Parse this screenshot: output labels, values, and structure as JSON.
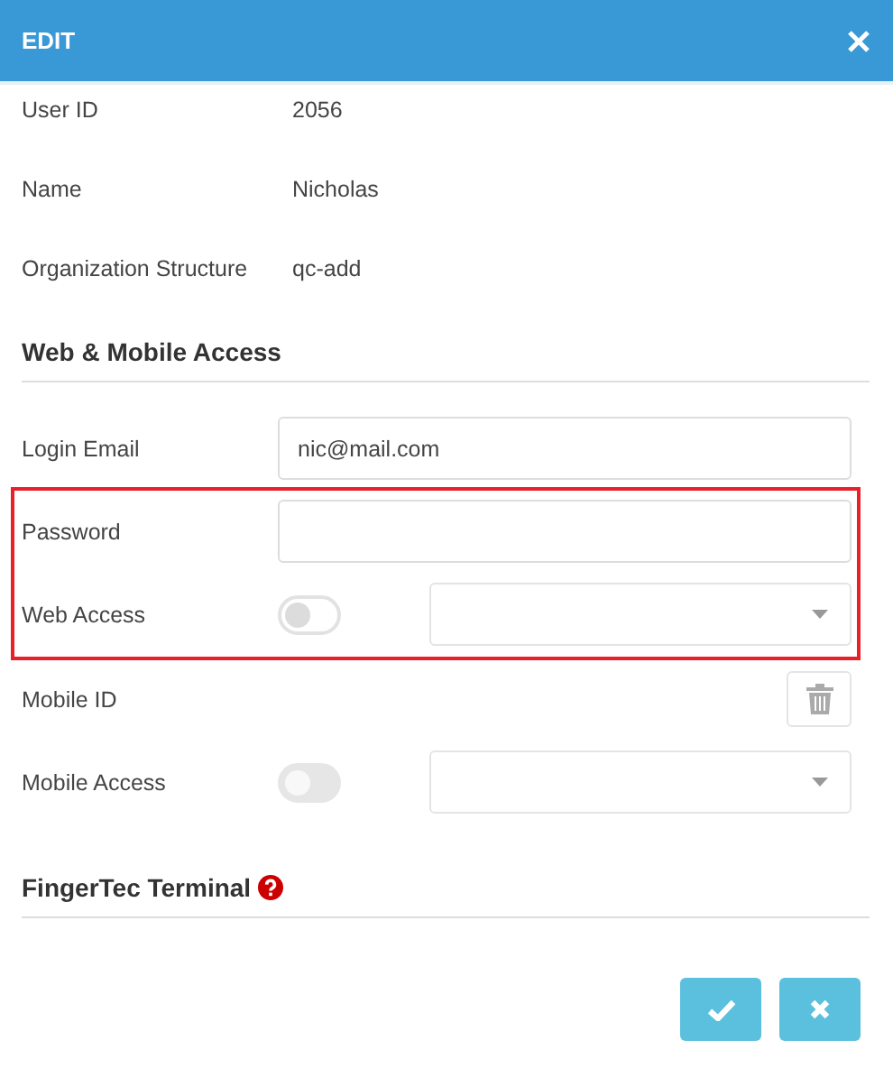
{
  "dialog": {
    "title": "EDIT"
  },
  "info_rows": [
    {
      "label": "User ID",
      "value": "2056"
    },
    {
      "label": "Name",
      "value": "Nicholas"
    },
    {
      "label": "Organization Structure",
      "value": "qc-add"
    }
  ],
  "sections": [
    {
      "heading": "Web & Mobile Access",
      "help": false,
      "fields": [
        {
          "kind": "text",
          "label": "Login Email",
          "value": "nic@mail.com",
          "highlighted": false
        },
        {
          "kind": "password",
          "label": "Password",
          "highlighted": true
        },
        {
          "kind": "toggle-select",
          "label": "Web Access",
          "on": false,
          "disabled": false,
          "highlighted": true
        },
        {
          "kind": "delete",
          "label": "Mobile ID",
          "highlighted": false
        },
        {
          "kind": "toggle-select",
          "label": "Mobile Access",
          "on": false,
          "disabled": true,
          "highlighted": false
        }
      ]
    },
    {
      "heading": "FingerTec Terminal",
      "help": true
    }
  ],
  "actions": [
    {
      "kind": "save"
    },
    {
      "kind": "cancel"
    }
  ]
}
